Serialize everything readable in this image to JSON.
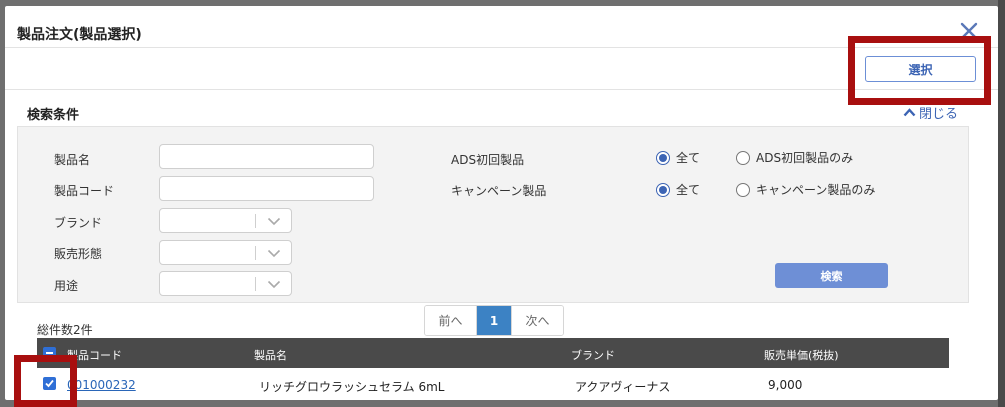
{
  "modal": {
    "title": "製品注文(製品選択)",
    "select_label": "選択",
    "close_icon": "close-icon"
  },
  "conditions": {
    "title": "検索条件",
    "collapse_label": "閉じる",
    "product_name_label": "製品名",
    "product_code_label": "製品コード",
    "brand_label": "ブランド",
    "sales_form_label": "販売形態",
    "usage_label": "用途",
    "ads_label": "ADS初回製品",
    "ads_options": [
      "全て",
      "ADS初回製品のみ"
    ],
    "ads_selected": "全て",
    "campaign_label": "キャンペーン製品",
    "campaign_options": [
      "全て",
      "キャンペーン製品のみ"
    ],
    "campaign_selected": "全て",
    "search_label": "検索"
  },
  "pagination": {
    "prev": "前へ",
    "current": "1",
    "next": "次へ"
  },
  "results": {
    "total": "総件数2件",
    "columns": [
      "製品コード",
      "製品名",
      "ブランド",
      "販売単価(税抜)"
    ],
    "rows": [
      {
        "code": "001000232",
        "name": "リッチグロウラッシュセラム 6mL",
        "brand": "アクアヴィーナス",
        "price": "9,000"
      }
    ]
  },
  "colors": {
    "accent": "#3c64b4",
    "highlight": "#a80f0f",
    "header": "#4a4a4a"
  }
}
